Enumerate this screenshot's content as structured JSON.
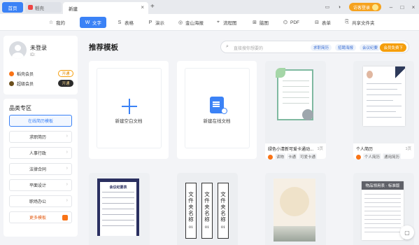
{
  "titlebar": {
    "tabs": [
      {
        "label": "首页"
      },
      {
        "label": "稻壳"
      },
      {
        "label": "新建"
      }
    ],
    "login_label": "访客登录"
  },
  "toolbar": {
    "items": [
      {
        "label": "我的",
        "icon": "star-icon"
      },
      {
        "label": "文字",
        "icon": "word-icon",
        "active": true
      },
      {
        "label": "表格",
        "icon": "table-icon"
      },
      {
        "label": "演示",
        "icon": "presentation-icon"
      },
      {
        "label": "金山海报",
        "icon": "poster-icon"
      },
      {
        "label": "流程图",
        "icon": "flowchart-icon"
      },
      {
        "label": "脑图",
        "icon": "mindmap-icon"
      },
      {
        "label": "PDF",
        "icon": "pdf-icon"
      },
      {
        "label": "表单",
        "icon": "form-icon"
      },
      {
        "label": "共享文件夹",
        "icon": "share-folder-icon"
      }
    ]
  },
  "user": {
    "name": "未登录",
    "id_label": "ID:",
    "vip_rows": [
      {
        "label": "稻壳会员",
        "button": "开通",
        "color": "#f97316"
      },
      {
        "label": "超级会员",
        "button": "开通",
        "color": "#a16207"
      }
    ]
  },
  "category": {
    "title": "品类专区",
    "items": [
      {
        "label": "在线简历模板",
        "active": true
      },
      {
        "label": "求职简历"
      },
      {
        "label": "人事行政"
      },
      {
        "label": "法律合同"
      },
      {
        "label": "平面设计"
      },
      {
        "label": "职场办公"
      },
      {
        "label": "更多模板",
        "more": true
      }
    ]
  },
  "main": {
    "title": "推荐模板",
    "search_placeholder": "直接搜你想要的",
    "search_chips": [
      "求职简历",
      "招聘海报",
      "会议纪要"
    ],
    "vip_chip": "会员免费下",
    "blank_doc": "新建空白文档",
    "online_doc": "新建在线文档",
    "templates": [
      {
        "title": "绿色小清新可爱卡通动...",
        "pages": "1页",
        "tags": [
          "读物",
          "卡通",
          "可爱卡通"
        ]
      },
      {
        "title": "个人简历",
        "pages": "1页",
        "tags": [
          "个人简历",
          "通用简历"
        ]
      }
    ],
    "thumb_texts": {
      "meeting_header": "会议纪要表",
      "folder_text": [
        "文",
        "件",
        "夹",
        "名",
        "称"
      ],
      "folder_num": "01",
      "supplies_header": "物品领用表 · 标准版"
    }
  }
}
